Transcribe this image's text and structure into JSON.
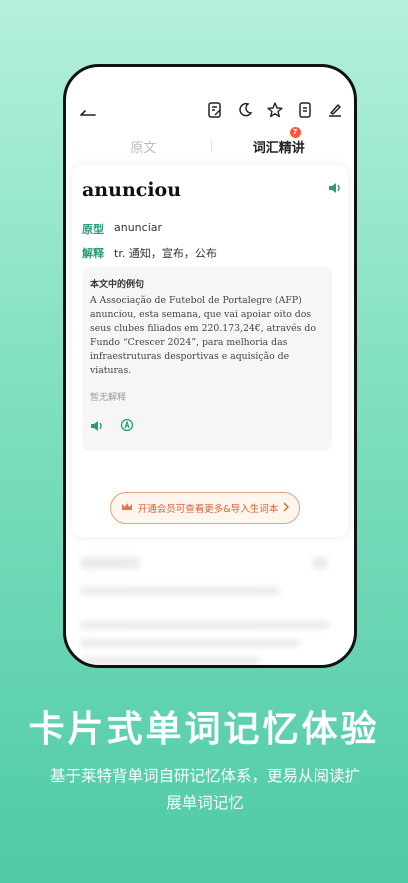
{
  "tabs": {
    "original": "原文",
    "vocab": "词汇精讲",
    "badge": "7"
  },
  "word_card": {
    "word": "anunciou",
    "lemma_label": "原型",
    "lemma": "anunciar",
    "definition_label": "解释",
    "definition": "tr. 通知，宣布，公布",
    "example_title": "本文中的例句",
    "example_text": "A Associação de Futebol de Portalegre (AFP) anunciou, esta semana, que vai apoiar oito dos seus clubes filiados em 220.173,24€, através do Fundo “Crescer 2024”, para melhoria das infraestruturas desportivas e aquisição de viaturas.",
    "example_note": "暂无解释"
  },
  "vip_banner": "开通会员可查看更多&导入生词本",
  "promo": {
    "headline": "卡片式单词记忆体验",
    "subtitle": "基于莱特背单词自研记忆体系，更易从阅读扩展单词记忆"
  },
  "colors": {
    "accent": "#2a9c7c",
    "vip": "#d9602e",
    "badge": "#f05a3a"
  }
}
